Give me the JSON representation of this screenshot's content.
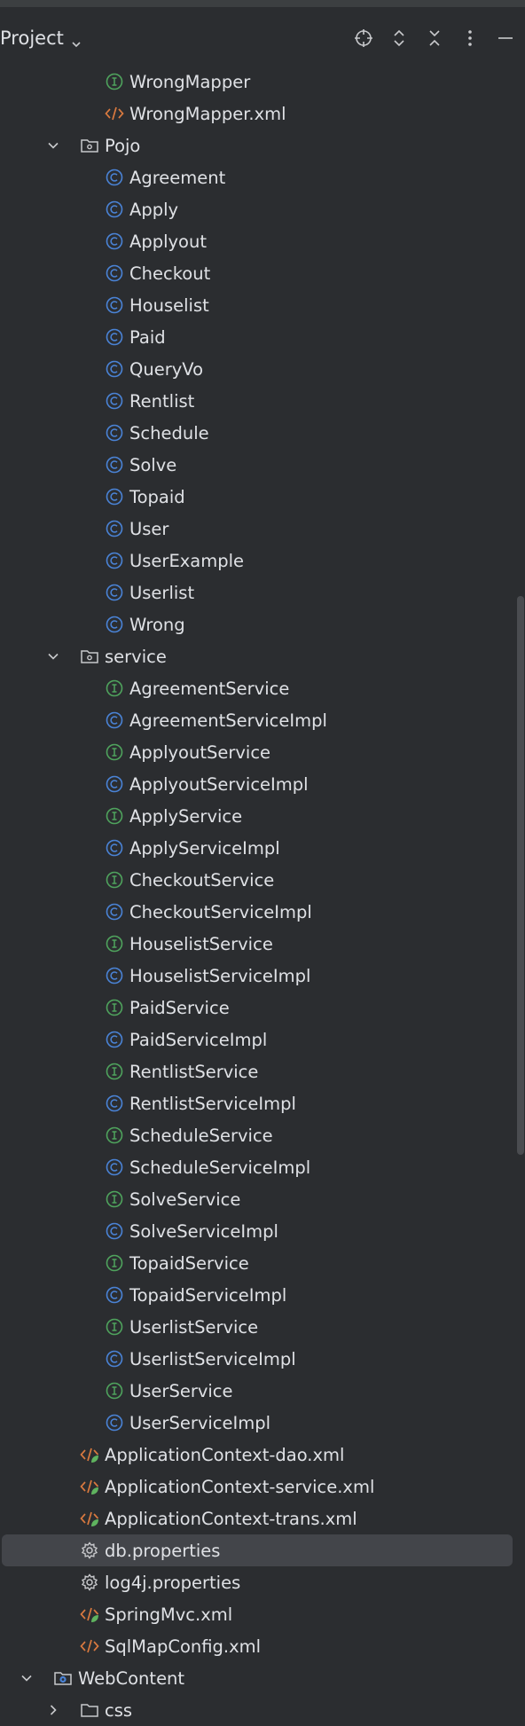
{
  "header": {
    "title": "Project"
  },
  "colors": {
    "interface": "#4fa35d",
    "class": "#4a83d6",
    "xml": "#d9793f",
    "spring_leaf": "#5fb35f",
    "folder": "#c8c9cc",
    "selected_bg": "#43454a"
  },
  "tree": {
    "rows": [
      {
        "label": "WrongMapper",
        "icon": "interface-icon"
      },
      {
        "label": "WrongMapper.xml",
        "icon": "xml-icon"
      },
      {
        "label": "Pojo",
        "icon": "package-icon",
        "expanded": true
      },
      {
        "label": "Agreement",
        "icon": "class-icon"
      },
      {
        "label": "Apply",
        "icon": "class-icon"
      },
      {
        "label": "Applyout",
        "icon": "class-icon"
      },
      {
        "label": "Checkout",
        "icon": "class-icon"
      },
      {
        "label": "Houselist",
        "icon": "class-icon"
      },
      {
        "label": "Paid",
        "icon": "class-icon"
      },
      {
        "label": "QueryVo",
        "icon": "class-icon"
      },
      {
        "label": "Rentlist",
        "icon": "class-icon"
      },
      {
        "label": "Schedule",
        "icon": "class-icon"
      },
      {
        "label": "Solve",
        "icon": "class-icon"
      },
      {
        "label": "Topaid",
        "icon": "class-icon"
      },
      {
        "label": "User",
        "icon": "class-icon"
      },
      {
        "label": "UserExample",
        "icon": "class-icon"
      },
      {
        "label": "Userlist",
        "icon": "class-icon"
      },
      {
        "label": "Wrong",
        "icon": "class-icon"
      },
      {
        "label": "service",
        "icon": "package-icon",
        "expanded": true
      },
      {
        "label": "AgreementService",
        "icon": "interface-icon"
      },
      {
        "label": "AgreementServiceImpl",
        "icon": "class-icon"
      },
      {
        "label": "ApplyoutService",
        "icon": "interface-icon"
      },
      {
        "label": "ApplyoutServiceImpl",
        "icon": "class-icon"
      },
      {
        "label": "ApplyService",
        "icon": "interface-icon"
      },
      {
        "label": "ApplyServiceImpl",
        "icon": "class-icon"
      },
      {
        "label": "CheckoutService",
        "icon": "interface-icon"
      },
      {
        "label": "CheckoutServiceImpl",
        "icon": "class-icon"
      },
      {
        "label": "HouselistService",
        "icon": "interface-icon"
      },
      {
        "label": "HouselistServiceImpl",
        "icon": "class-icon"
      },
      {
        "label": "PaidService",
        "icon": "interface-icon"
      },
      {
        "label": "PaidServiceImpl",
        "icon": "class-icon"
      },
      {
        "label": "RentlistService",
        "icon": "interface-icon"
      },
      {
        "label": "RentlistServiceImpl",
        "icon": "class-icon"
      },
      {
        "label": "ScheduleService",
        "icon": "interface-icon"
      },
      {
        "label": "ScheduleServiceImpl",
        "icon": "class-icon"
      },
      {
        "label": "SolveService",
        "icon": "interface-icon"
      },
      {
        "label": "SolveServiceImpl",
        "icon": "class-icon"
      },
      {
        "label": "TopaidService",
        "icon": "interface-icon"
      },
      {
        "label": "TopaidServiceImpl",
        "icon": "class-icon"
      },
      {
        "label": "UserlistService",
        "icon": "interface-icon"
      },
      {
        "label": "UserlistServiceImpl",
        "icon": "class-icon"
      },
      {
        "label": "UserService",
        "icon": "interface-icon"
      },
      {
        "label": "UserServiceImpl",
        "icon": "class-icon"
      },
      {
        "label": "ApplicationContext-dao.xml",
        "icon": "spring-xml-icon"
      },
      {
        "label": "ApplicationContext-service.xml",
        "icon": "spring-xml-icon"
      },
      {
        "label": "ApplicationContext-trans.xml",
        "icon": "spring-xml-icon"
      },
      {
        "label": "db.properties",
        "icon": "properties-icon",
        "selected": true
      },
      {
        "label": "log4j.properties",
        "icon": "properties-icon"
      },
      {
        "label": "SpringMvc.xml",
        "icon": "spring-xml-icon"
      },
      {
        "label": "SqlMapConfig.xml",
        "icon": "xml-icon"
      },
      {
        "label": "WebContent",
        "icon": "web-folder-icon",
        "expanded": true
      },
      {
        "label": "css",
        "icon": "folder-icon",
        "expanded": false
      }
    ]
  }
}
